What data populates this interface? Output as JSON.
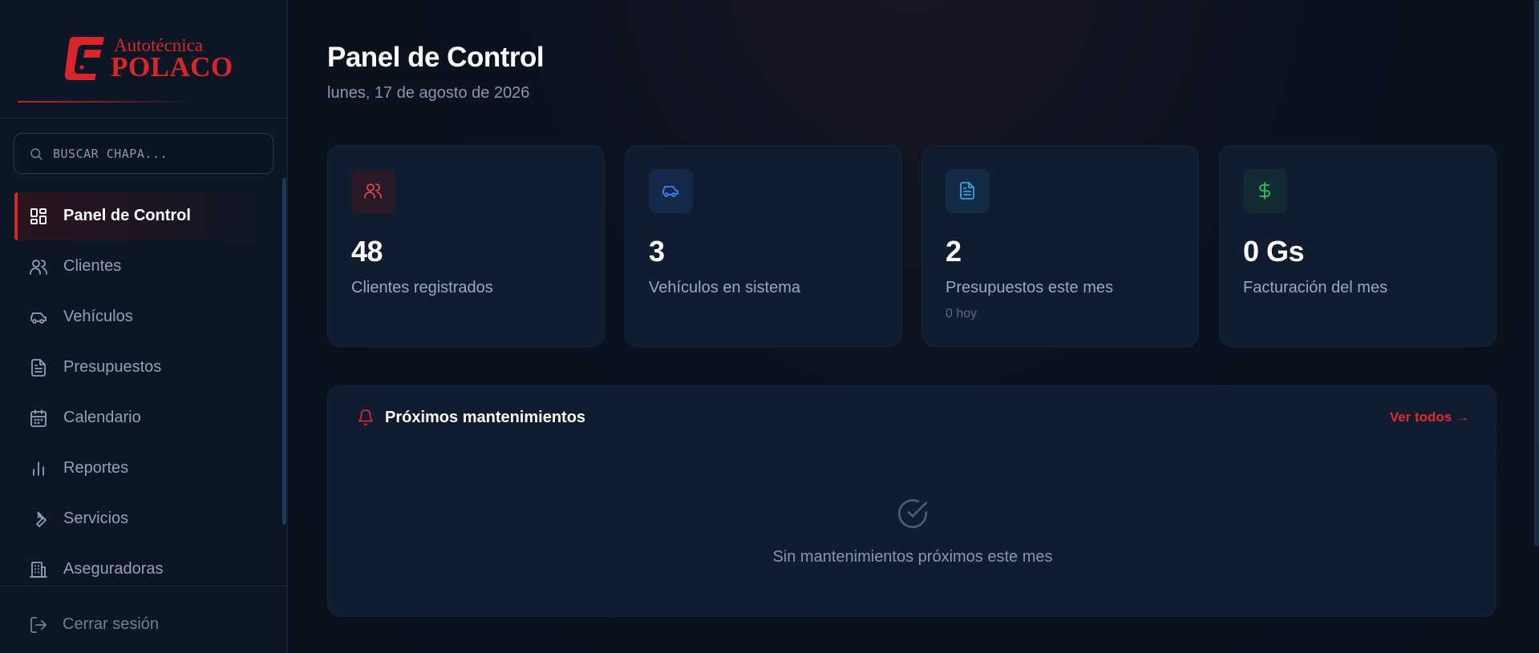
{
  "brand": {
    "name_line1": "Autotécnica",
    "name_line2": "POLACO",
    "accent_color": "#d9262a"
  },
  "sidebar": {
    "search_placeholder": "BUSCAR CHAPA...",
    "items": [
      {
        "label": "Panel de Control",
        "icon": "dashboard-icon",
        "active": true
      },
      {
        "label": "Clientes",
        "icon": "users-icon",
        "active": false
      },
      {
        "label": "Vehículos",
        "icon": "car-icon",
        "active": false
      },
      {
        "label": "Presupuestos",
        "icon": "document-icon",
        "active": false
      },
      {
        "label": "Calendario",
        "icon": "calendar-icon",
        "active": false
      },
      {
        "label": "Reportes",
        "icon": "bar-chart-icon",
        "active": false
      },
      {
        "label": "Servicios",
        "icon": "wrench-icon",
        "active": false
      },
      {
        "label": "Aseguradoras",
        "icon": "building-icon",
        "active": false
      }
    ],
    "logout_label": "Cerrar sesión"
  },
  "header": {
    "title": "Panel de Control",
    "date": "lunes, 17 de agosto de 2026"
  },
  "stats": [
    {
      "value": "48",
      "label": "Clientes registrados",
      "icon": "users-icon",
      "color": "#e0474b"
    },
    {
      "value": "3",
      "label": "Vehículos en sistema",
      "icon": "car-icon",
      "color": "#3b82f6"
    },
    {
      "value": "2",
      "label": "Presupuestos este mes",
      "sub": "0 hoy",
      "icon": "document-icon",
      "color": "#38a3dc"
    },
    {
      "value": "0 Gs",
      "label": "Facturación del mes",
      "icon": "dollar-icon",
      "color": "#22c55e"
    }
  ],
  "maintenance": {
    "title": "Próximos mantenimientos",
    "link_label": "Ver todos →",
    "empty_text": "Sin mantenimientos próximos este mes"
  }
}
